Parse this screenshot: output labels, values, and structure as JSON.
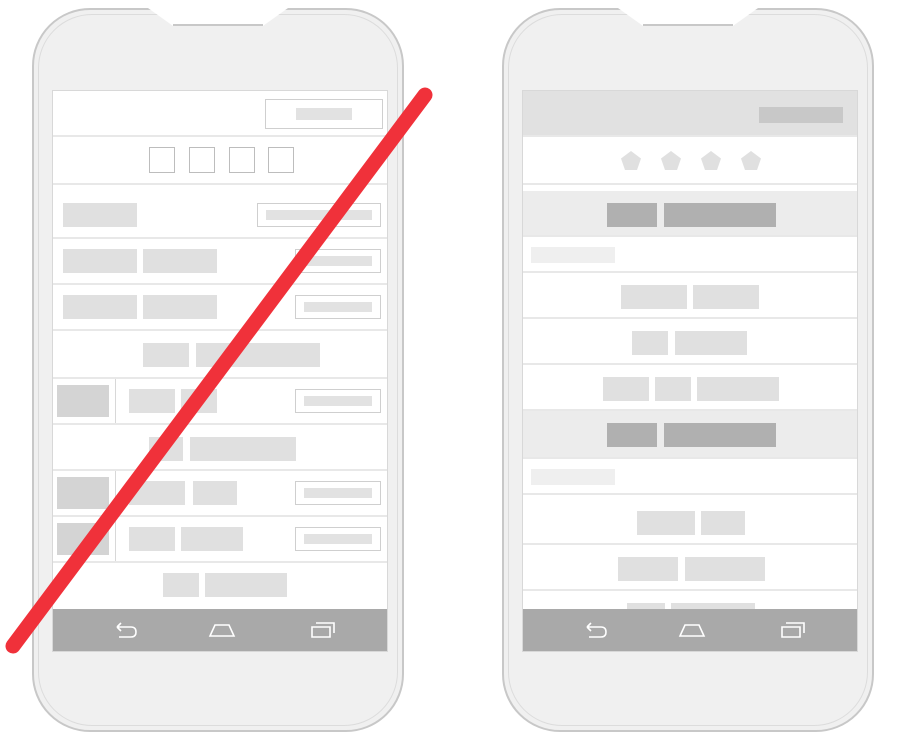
{
  "figure": {
    "left_phone": {
      "status": "crossed-out",
      "cross_color": "#f0313a",
      "nav_icons": [
        "back-icon",
        "home-icon",
        "recents-icon"
      ]
    },
    "right_phone": {
      "status": "recommended",
      "header_color": "#e1e1e1",
      "nav_icons": [
        "back-icon",
        "home-icon",
        "recents-icon"
      ]
    }
  }
}
